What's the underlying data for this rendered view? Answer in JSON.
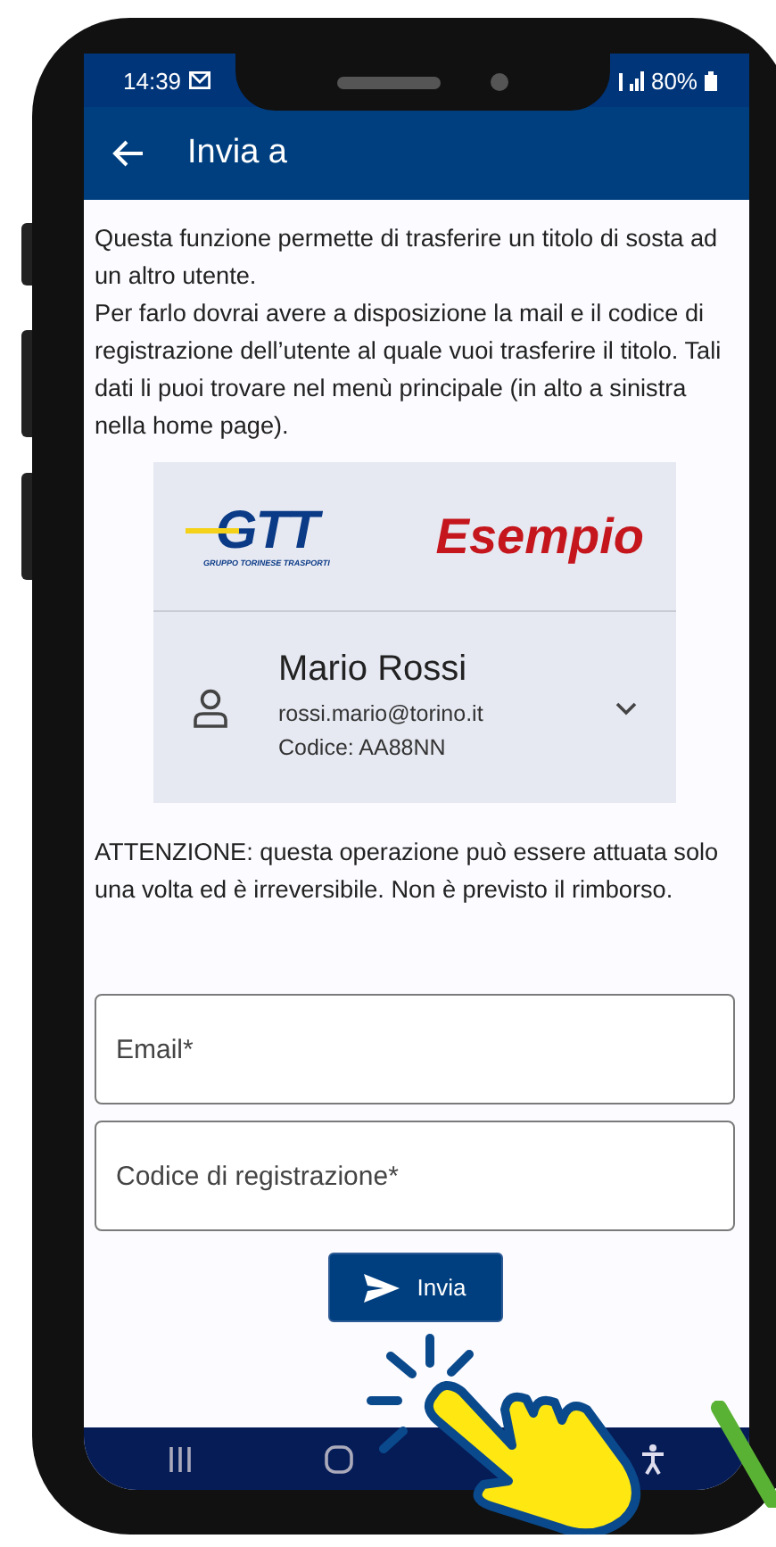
{
  "status_bar": {
    "time": "14:39",
    "battery": "80%"
  },
  "app_bar": {
    "title": "Invia a"
  },
  "intro": [
    "Questa funzione permette di trasferire un titolo di sosta ad un altro utente.",
    "Per farlo dovrai avere a disposizione la mail e il codice di registrazione dell’utente al quale vuoi trasferire il titolo. Tali dati li puoi trovare nel menù principale (in alto a sinistra nella home page)."
  ],
  "account_card": {
    "logo_text": "GTT",
    "logo_subtitle": "GRUPPO TORINESE TRASPORTI",
    "brand_label": "Esempio",
    "user": {
      "name": "Mario Rossi",
      "email": "rossi.mario@torino.it",
      "code": "Codice: AA88NN",
      "expanded": false
    }
  },
  "warning": "ATTENZIONE: questa operazione può essere attuata solo una volta ed è irreversibile. Non è previsto il rimborso.",
  "fields": [
    {
      "placeholder": "Email*"
    },
    {
      "placeholder": "Codice di registrazione*"
    }
  ],
  "submit_button": {
    "label": "Invia"
  }
}
